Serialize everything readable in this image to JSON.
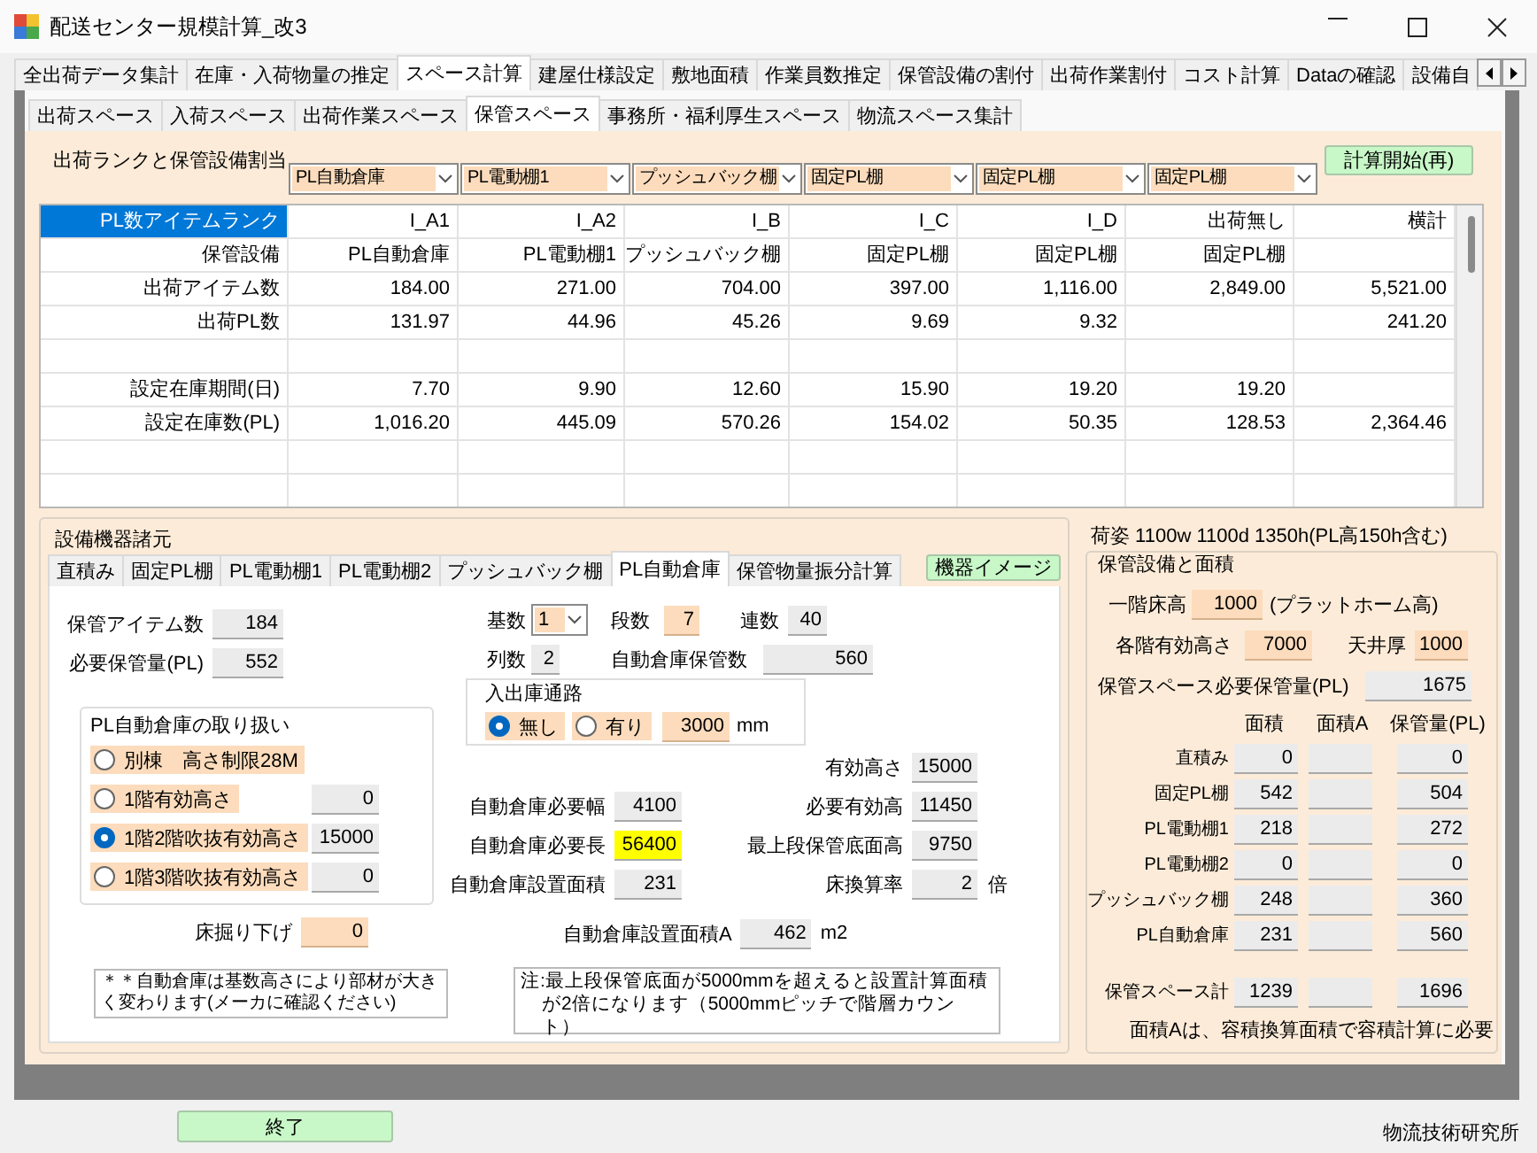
{
  "window": {
    "title": "配送センター規模計算_改3"
  },
  "main_tabs": [
    {
      "label": "全出荷データ集計",
      "selected": false
    },
    {
      "label": "在庫・入荷物量の推定",
      "selected": false
    },
    {
      "label": "スペース計算",
      "selected": true
    },
    {
      "label": "建屋仕様設定",
      "selected": false
    },
    {
      "label": "敷地面積",
      "selected": false
    },
    {
      "label": "作業員数推定",
      "selected": false
    },
    {
      "label": "保管設備の割付",
      "selected": false
    },
    {
      "label": "出荷作業割付",
      "selected": false
    },
    {
      "label": "コスト計算",
      "selected": false
    },
    {
      "label": "Dataの確認",
      "selected": false
    },
    {
      "label": "設備自",
      "selected": false
    }
  ],
  "sub_tabs": [
    {
      "label": "出荷スペース",
      "selected": false
    },
    {
      "label": "入荷スペース",
      "selected": false
    },
    {
      "label": "出荷作業スペース",
      "selected": false
    },
    {
      "label": "保管スペース",
      "selected": true
    },
    {
      "label": "事務所・福利厚生スペース",
      "selected": false
    },
    {
      "label": "物流スペース集計",
      "selected": false
    }
  ],
  "allocation": {
    "title": "出荷ランクと保管設備割当",
    "combos": [
      "PL自動倉庫",
      "PL電動棚1",
      "プッシュバック棚",
      "固定PL棚",
      "固定PL棚",
      "固定PL棚"
    ],
    "button": "計算開始(再)",
    "table": {
      "rows": [
        {
          "header": "PL数アイテムランク",
          "selected": true,
          "cells": [
            "I_A1",
            "I_A2",
            "I_B",
            "I_C",
            "I_D",
            "出荷無し",
            "横計"
          ]
        },
        {
          "header": "保管設備",
          "selected": false,
          "cells": [
            "PL自動倉庫",
            "PL電動棚1",
            "プッシュバック棚",
            "固定PL棚",
            "固定PL棚",
            "固定PL棚",
            null
          ]
        },
        {
          "header": "出荷アイテム数",
          "selected": false,
          "cells": [
            "184.00",
            "271.00",
            "704.00",
            "397.00",
            "1,116.00",
            "2,849.00",
            "5,521.00"
          ]
        },
        {
          "header": "出荷PL数",
          "selected": false,
          "cells": [
            "131.97",
            "44.96",
            "45.26",
            "9.69",
            "9.32",
            null,
            "241.20"
          ]
        },
        {
          "selected": false
        },
        {
          "header": "設定在庫期間(日)",
          "selected": false,
          "cells": [
            "7.70",
            "9.90",
            "12.60",
            "15.90",
            "19.20",
            "19.20",
            null
          ]
        },
        {
          "header": "設定在庫数(PL)",
          "selected": false,
          "cells": [
            "1,016.20",
            "445.09",
            "570.26",
            "154.02",
            "50.35",
            "128.53",
            "2,364.46"
          ]
        },
        {
          "selected": false
        }
      ]
    }
  },
  "equipment": {
    "title": "設備機器諸元",
    "tabs": [
      {
        "label": "直積み",
        "selected": false
      },
      {
        "label": "固定PL棚",
        "selected": false
      },
      {
        "label": "PL電動棚1",
        "selected": false
      },
      {
        "label": "PL電動棚2",
        "selected": false
      },
      {
        "label": "プッシュバック棚",
        "selected": false
      },
      {
        "label": "PL自動倉庫",
        "selected": true
      },
      {
        "label": "保管物量振分計算",
        "selected": false
      }
    ],
    "image_button": "機器イメージ",
    "basic": [
      {
        "label": "保管アイテム数",
        "value": "184",
        "kind": "output"
      },
      {
        "label": "必要保管量(PL)",
        "value": "552",
        "kind": "output"
      }
    ],
    "handling": {
      "title": "PL自動倉庫の取り扱い",
      "options": [
        {
          "label": "別棟　高さ制限28M",
          "selected": false
        },
        {
          "label": "1階有効高さ",
          "selected": false,
          "value": "0"
        },
        {
          "label": "1階2階吹抜有効高さ",
          "selected": true,
          "value": "15000"
        },
        {
          "label": "1階3階吹抜有効高さ",
          "selected": false,
          "value": "0"
        }
      ]
    },
    "floor_dig": {
      "label": "床掘り下げ",
      "value": "0",
      "kind": "input"
    },
    "note_left": "＊＊自動倉庫は基数高さにより部材が大きく変わります(メーカに確認ください)",
    "units": {
      "label": "基数",
      "value": "1"
    },
    "levels": {
      "label": "段数",
      "value": "7",
      "kind": "input"
    },
    "bays": {
      "label": "連数",
      "value": "40",
      "kind": "output"
    },
    "rows_count": {
      "label": "列数",
      "value": "2",
      "kind": "output"
    },
    "capacity": {
      "label": "自動倉庫保管数",
      "value": "560",
      "kind": "output"
    },
    "aisle": {
      "title": "入出庫通路",
      "options": [
        {
          "label": "無し",
          "selected": true
        },
        {
          "label": "有り",
          "selected": false
        }
      ],
      "width": {
        "value": "3000",
        "kind": "input"
      },
      "unit": "mm"
    },
    "pairs": [
      {
        "right": {
          "label": "有効高さ",
          "value": "15000",
          "kind": "output"
        }
      },
      {
        "left": {
          "label": "自動倉庫必要幅",
          "value": "4100",
          "kind": "output"
        },
        "right": {
          "label": "必要有効高",
          "value": "11450",
          "kind": "output"
        }
      },
      {
        "left": {
          "label": "自動倉庫必要長",
          "value": "56400",
          "kind": "warning"
        },
        "right": {
          "label": "最上段保管底面高",
          "value": "9750",
          "kind": "output"
        }
      },
      {
        "left": {
          "label": "自動倉庫設置面積",
          "value": "231",
          "kind": "output"
        },
        "right": {
          "label": "床換算率",
          "value": "2",
          "kind": "output",
          "unit": "倍"
        }
      }
    ],
    "area_a": {
      "label": "自動倉庫設置面積A",
      "value": "462",
      "kind": "output",
      "unit": "m2"
    },
    "note_right": "注:最上段保管底面が5000mmを超えると設置計算面積が2倍になります（5000mmピッチで階層カウント）"
  },
  "storage": {
    "package": "荷姿 1100w 1100d 1350h(PL高150h含む)",
    "title": "保管設備と面積",
    "floor_height": {
      "label": "一階床高",
      "value": "1000",
      "kind": "input",
      "note": "(プラットホーム高)"
    },
    "floor_eff": {
      "label": "各階有効高さ",
      "value": "7000",
      "kind": "input"
    },
    "ceiling": {
      "label": "天井厚",
      "value": "1000",
      "kind": "input"
    },
    "required": {
      "label": "保管スペース必要保管量(PL)",
      "value": "1675",
      "kind": "output"
    },
    "columns": [
      "面積",
      "面積A",
      "保管量(PL)"
    ],
    "rows": [
      {
        "label": "直積み",
        "area": "0",
        "volume": "0"
      },
      {
        "label": "固定PL棚",
        "area": "542",
        "volume": "504"
      },
      {
        "label": "PL電動棚1",
        "area": "218",
        "volume": "272"
      },
      {
        "label": "PL電動棚2",
        "area": "0",
        "volume": "0"
      },
      {
        "label": "プッシュバック棚",
        "area": "248",
        "volume": "360"
      },
      {
        "label": "PL自動倉庫",
        "area": "231",
        "volume": "560"
      }
    ],
    "total": {
      "label": "保管スペース計",
      "area": "1239",
      "volume": "1696"
    },
    "footnote": "面積Aは、容積換算面積で容積計算に必要"
  },
  "footer": {
    "exit_button": "終了",
    "credit": "物流技術研究所"
  }
}
